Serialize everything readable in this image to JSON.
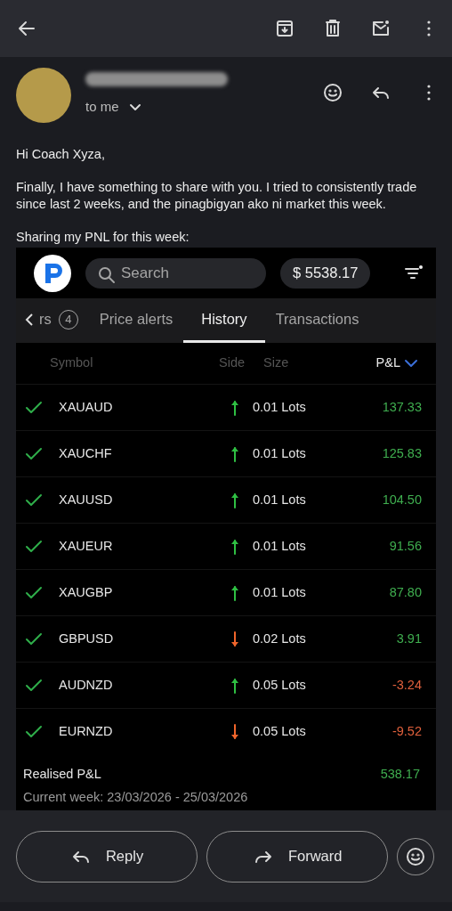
{
  "header": {
    "recipient": "to me"
  },
  "message": {
    "paragraphs": [
      "Hi Coach Xyza,",
      "Finally, I have something to share with you. I tried to consistently trade since last 2 weeks, and the pinagbigyan ako ni market this week.",
      "Sharing my PNL for this week:"
    ]
  },
  "app": {
    "search": {
      "placeholder": "Search"
    },
    "balance": "$ 5538.17",
    "filter_dot": true,
    "tabs": [
      {
        "label": "rs",
        "count": "4",
        "selected": false,
        "scroll_back": true
      },
      {
        "label": "Price alerts",
        "selected": false
      },
      {
        "label": "History",
        "selected": true
      },
      {
        "label": "Transactions",
        "selected": false
      }
    ],
    "table": {
      "columns": [
        "Symbol",
        "Side",
        "Size",
        "P&L"
      ],
      "rows": [
        {
          "symbol": "XAUAUD",
          "buy": true,
          "size": "0.01 Lots",
          "pnl": "137.33",
          "positive": true
        },
        {
          "symbol": "XAUCHF",
          "buy": true,
          "size": "0.01 Lots",
          "pnl": "125.83",
          "positive": true
        },
        {
          "symbol": "XAUUSD",
          "buy": true,
          "size": "0.01 Lots",
          "pnl": "104.50",
          "positive": true
        },
        {
          "symbol": "XAUEUR",
          "buy": true,
          "size": "0.01 Lots",
          "pnl": "91.56",
          "positive": true
        },
        {
          "symbol": "XAUGBP",
          "buy": true,
          "size": "0.01 Lots",
          "pnl": "87.80",
          "positive": true
        },
        {
          "symbol": "GBPUSD",
          "buy": false,
          "size": "0.02 Lots",
          "pnl": "3.91",
          "positive": true
        },
        {
          "symbol": "AUDNZD",
          "buy": true,
          "size": "0.05 Lots",
          "pnl": "-3.24",
          "positive": false
        },
        {
          "symbol": "EURNZD",
          "buy": false,
          "size": "0.05 Lots",
          "pnl": "-9.52",
          "positive": false
        }
      ]
    },
    "summary": {
      "label": "Realised P&L",
      "value": "538.17",
      "period": "Current week: 23/03/2026 - 25/03/2026"
    }
  },
  "actions": [
    "Reply",
    "Forward"
  ]
}
